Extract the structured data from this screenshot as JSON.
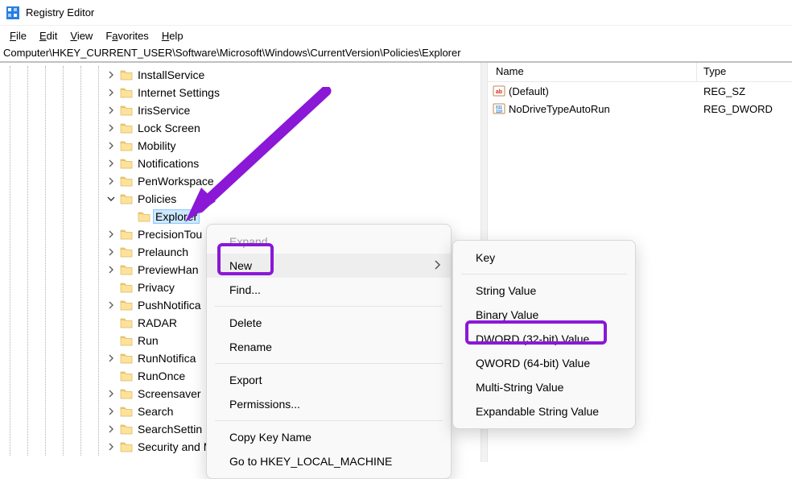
{
  "title": "Registry Editor",
  "menubar": {
    "file": "File",
    "edit": "Edit",
    "view": "View",
    "favorites": "Favorites",
    "help": "Help"
  },
  "path": "Computer\\HKEY_CURRENT_USER\\Software\\Microsoft\\Windows\\CurrentVersion\\Policies\\Explorer",
  "tree": {
    "items": [
      {
        "label": "InstallService",
        "chev": "right",
        "indent": 145,
        "line_set": "A"
      },
      {
        "label": "Internet Settings",
        "chev": "right",
        "indent": 145,
        "line_set": "A"
      },
      {
        "label": "IrisService",
        "chev": "right",
        "indent": 145,
        "line_set": "A"
      },
      {
        "label": "Lock Screen",
        "chev": "right",
        "indent": 145,
        "line_set": "A"
      },
      {
        "label": "Mobility",
        "chev": "right",
        "indent": 145,
        "line_set": "A"
      },
      {
        "label": "Notifications",
        "chev": "right",
        "indent": 145,
        "line_set": "A"
      },
      {
        "label": "PenWorkspace",
        "chev": "right",
        "indent": 145,
        "line_set": "A"
      },
      {
        "label": "Policies",
        "chev": "down",
        "indent": 145,
        "line_set": "A"
      },
      {
        "label": "Explorer",
        "chev": "none",
        "indent": 167,
        "line_set": "B",
        "selected": true
      },
      {
        "label": "PrecisionTou",
        "chev": "right",
        "indent": 145,
        "line_set": "A"
      },
      {
        "label": "Prelaunch",
        "chev": "right",
        "indent": 145,
        "line_set": "A"
      },
      {
        "label": "PreviewHan",
        "chev": "right",
        "indent": 145,
        "line_set": "A"
      },
      {
        "label": "Privacy",
        "chev": "none",
        "indent": 145,
        "line_set": "A"
      },
      {
        "label": "PushNotifica",
        "chev": "right",
        "indent": 145,
        "line_set": "A"
      },
      {
        "label": "RADAR",
        "chev": "none",
        "indent": 145,
        "line_set": "A"
      },
      {
        "label": "Run",
        "chev": "none",
        "indent": 145,
        "line_set": "A"
      },
      {
        "label": "RunNotifica",
        "chev": "right",
        "indent": 145,
        "line_set": "A"
      },
      {
        "label": "RunOnce",
        "chev": "none",
        "indent": 145,
        "line_set": "A"
      },
      {
        "label": "Screensaver",
        "chev": "right",
        "indent": 145,
        "line_set": "A"
      },
      {
        "label": "Search",
        "chev": "right",
        "indent": 145,
        "line_set": "A"
      },
      {
        "label": "SearchSettin",
        "chev": "right",
        "indent": 145,
        "line_set": "A"
      },
      {
        "label": "Security and Maintenance",
        "chev": "right",
        "indent": 145,
        "line_set": "A"
      }
    ]
  },
  "list": {
    "columns": {
      "name": "Name",
      "type": "Type"
    },
    "rows": [
      {
        "name": "(Default)",
        "type": "REG_SZ",
        "icon": "sz"
      },
      {
        "name": "NoDriveTypeAutoRun",
        "type": "REG_DWORD",
        "icon": "dw"
      }
    ]
  },
  "context_menu": {
    "expand": "Expand",
    "new": "New",
    "find": "Find...",
    "delete": "Delete",
    "rename": "Rename",
    "export": "Export",
    "permissions": "Permissions...",
    "copy_key_name": "Copy Key Name",
    "go_to": "Go to HKEY_LOCAL_MACHINE"
  },
  "submenu": {
    "key": "Key",
    "string_value": "String Value",
    "binary_value": "Binary Value",
    "dword_value": "DWORD (32-bit) Value",
    "qword_value": "QWORD (64-bit) Value",
    "multi_string_value": "Multi-String Value",
    "expandable_string_value": "Expandable String Value"
  },
  "colors": {
    "annotation": "#8a18d6"
  }
}
